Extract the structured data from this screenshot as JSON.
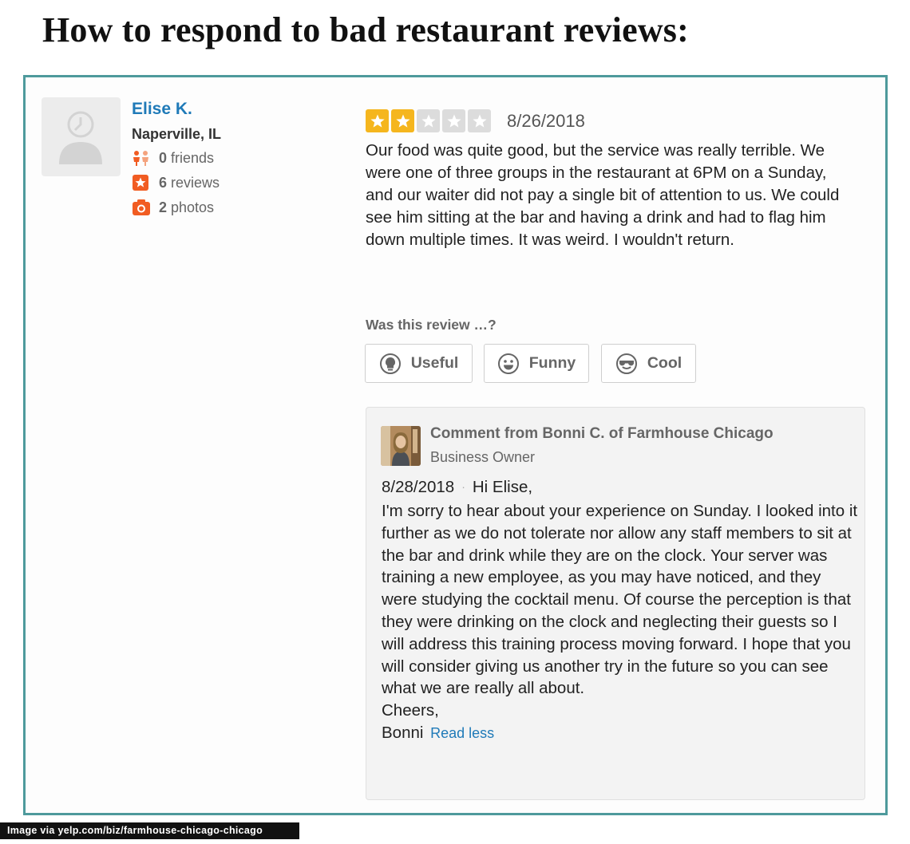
{
  "page": {
    "title": "How to respond to bad restaurant reviews:",
    "credit": "Image via yelp.com/biz/farmhouse-chicago-chicago"
  },
  "colors": {
    "frame_border": "#4e9a9c",
    "link_blue": "#1f7ab8",
    "star_on": "#f5b61e",
    "star_off": "#dcdcdc",
    "stat_orange": "#f15c22"
  },
  "reviewer": {
    "name": "Elise K.",
    "location": "Naperville, IL",
    "friends_count": "0",
    "friends_label": "friends",
    "reviews_count": "6",
    "reviews_label": "reviews",
    "photos_count": "2",
    "photos_label": "photos",
    "icons": [
      "friends-icon",
      "reviews-star-icon",
      "camera-icon"
    ]
  },
  "review": {
    "rating": 2,
    "max_rating": 5,
    "date": "8/26/2018",
    "text": "Our food was quite good, but the service was really terrible. We were one of three groups in the restaurant at 6PM on a Sunday, and our waiter did not pay a single bit of attention to us. We could see him sitting at the bar and having a drink and had to flag him down multiple times. It was weird. I wouldn't return."
  },
  "votes": {
    "prompt": "Was this review …?",
    "useful_label": "Useful",
    "funny_label": "Funny",
    "cool_label": "Cool"
  },
  "owner_comment": {
    "heading": "Comment from Bonni C. of Farmhouse Chicago",
    "role": "Business Owner",
    "date": "8/28/2018",
    "separator": "·",
    "greeting": "Hi Elise,",
    "body": "I'm sorry to hear about your experience on Sunday. I looked into it further as we do not tolerate nor allow any staff members to sit at the bar and drink while they are on the clock. Your server was training a new employee, as you may have noticed, and they were studying the cocktail menu. Of course the perception is that they were drinking on the clock and neglecting their guests so I will address this training process moving forward. I hope that you will consider giving us another try in the future so you can see what we are really all about.",
    "closing": "Cheers,",
    "signature": "Bonni",
    "read_less": "Read less"
  }
}
